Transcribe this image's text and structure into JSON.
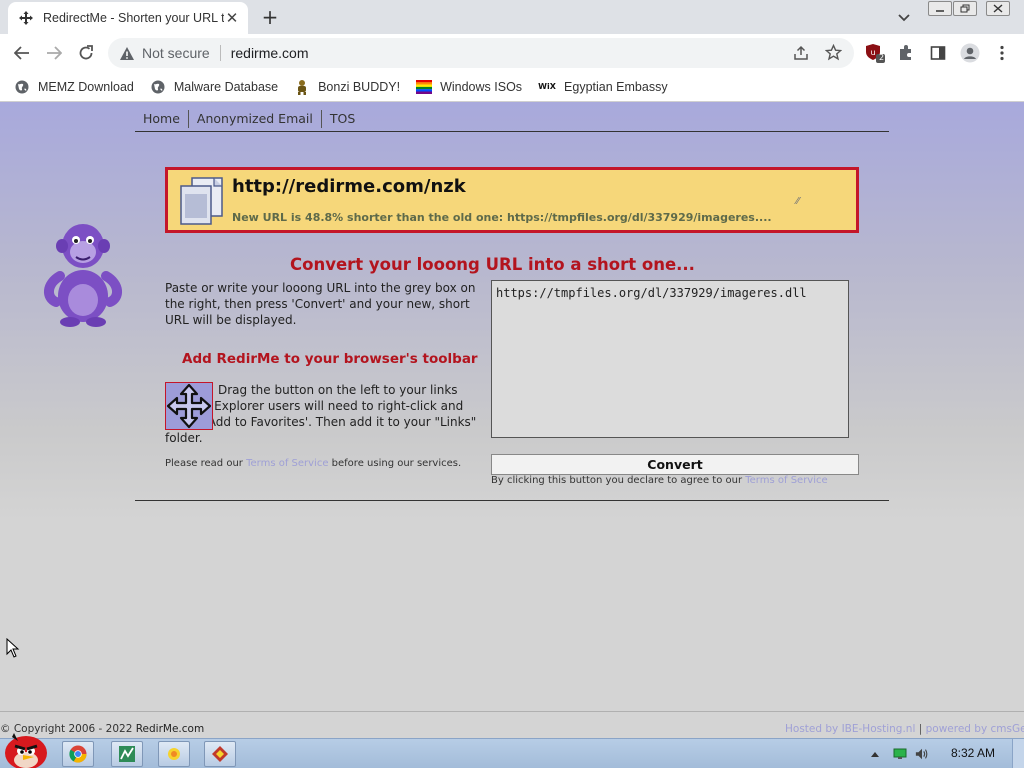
{
  "browser": {
    "tab_title": "RedirectMe - Shorten your URL t",
    "address_security": "Not secure",
    "address_url": "redirme.com",
    "extension_badge": "2",
    "bookmarks": [
      {
        "label": "MEMZ Download",
        "icon": "globe-icon"
      },
      {
        "label": "Malware Database",
        "icon": "globe-icon"
      },
      {
        "label": "Bonzi BUDDY!",
        "icon": "bonzi-icon"
      },
      {
        "label": "Windows ISOs",
        "icon": "windows-flag-icon"
      },
      {
        "label": "Egyptian Embassy",
        "icon": "wix-icon"
      }
    ],
    "wix_text": "WiX"
  },
  "nav": {
    "home": "Home",
    "anon_email": "Anonymized Email",
    "tos": "TOS"
  },
  "result": {
    "short_url": "http://redirme.com/nzk",
    "note": "New URL is 48.8% shorter than the old one: https://tmpfiles.org/dl/337929/imageres...."
  },
  "main": {
    "title": "Convert your looong URL into a short one...",
    "instructions": "Paste or write your looong URL into the grey box on the right, then press 'Convert' and your new, short URL will be displayed.",
    "toolbar_title": "Add RedirMe to your browser's toolbar",
    "drag_text": "Drag the button on the left to your links toolbar. Explorer users will need to right-click and select 'Add to Favorites'. Then add it to your \"Links\" folder.",
    "read_prefix": "Please read our ",
    "tos_link": "Terms of Service",
    "read_suffix": " before using our services.",
    "url_value": "https://tmpfiles.org/dl/337929/imageres.dll",
    "convert_label": "Convert",
    "convert_note_prefix": "By clicking this button you declare to agree to our ",
    "convert_note_link": "Terms of Service"
  },
  "footer": {
    "copyright_prefix": "© Copyright 2006 - 2022 ",
    "copyright_brand": "RedirMe.com",
    "hosted": "Hosted by IBE-Hosting.nl",
    "powered": "powered by cmsGear"
  },
  "taskbar": {
    "clock": "8:32 AM"
  },
  "colors": {
    "accent_red": "#b3141e",
    "result_bg": "#f6d77a",
    "link": "#9fa0d6"
  }
}
